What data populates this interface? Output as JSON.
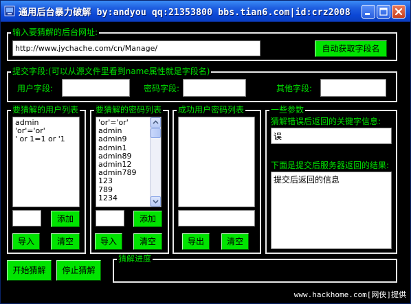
{
  "window": {
    "title": "通用后台暴力破解 by:andyou qq:21353800 bbs.tian6.com|id:crz2008"
  },
  "url_group": {
    "label": "输入要猜解的后台网址:",
    "url_value": "http://www.jychache.com/cn/Manage/",
    "auto_button": "自动获取字段名"
  },
  "fields_group": {
    "label": "提交字段:(可以从源文件里看到name属性就是字段名)",
    "user_field_label": "用户字段:",
    "password_field_label": "密码字段:",
    "other_field_label": "其他字段:",
    "user_field_value": "",
    "password_field_value": "",
    "other_field_value": ""
  },
  "user_list": {
    "label": "要猜解的用户列表",
    "items": [
      "admin",
      "'or'='or'",
      "' or 1=1 or '1"
    ],
    "input_value": "",
    "add_button": "添加",
    "import_button": "导入",
    "clear_button": "清空"
  },
  "password_list": {
    "label": "要猜解的密码列表",
    "items": [
      "'or'='or'",
      "admin",
      "admin9",
      "admin1",
      "admin89",
      "admin12",
      "admin789",
      "123",
      "789",
      "1234"
    ],
    "input_value": "",
    "add_button": "添加",
    "import_button": "导入",
    "clear_button": "清空"
  },
  "success_list": {
    "label": "成功用户密码列表",
    "items": [],
    "input_value": "",
    "export_button": "导出",
    "clear_button": "清空"
  },
  "params": {
    "label": "一些参数",
    "error_keyword_label": "猜解错误后返回的关键字信息:",
    "error_keyword_value": "误",
    "result_label": "下面是提交后服务器返回的结果:",
    "result_value": "提交后返回的信息"
  },
  "actions": {
    "start_button": "开始猜解",
    "stop_button": "停止猜解"
  },
  "progress": {
    "label": "猜解进度"
  },
  "watermark": "www.hackhome.com[网侠]提供",
  "colors": {
    "accent_green": "#00e000",
    "button_green": "#00e400",
    "background": "#000000",
    "titlebar_blue": "#0b47d6"
  }
}
